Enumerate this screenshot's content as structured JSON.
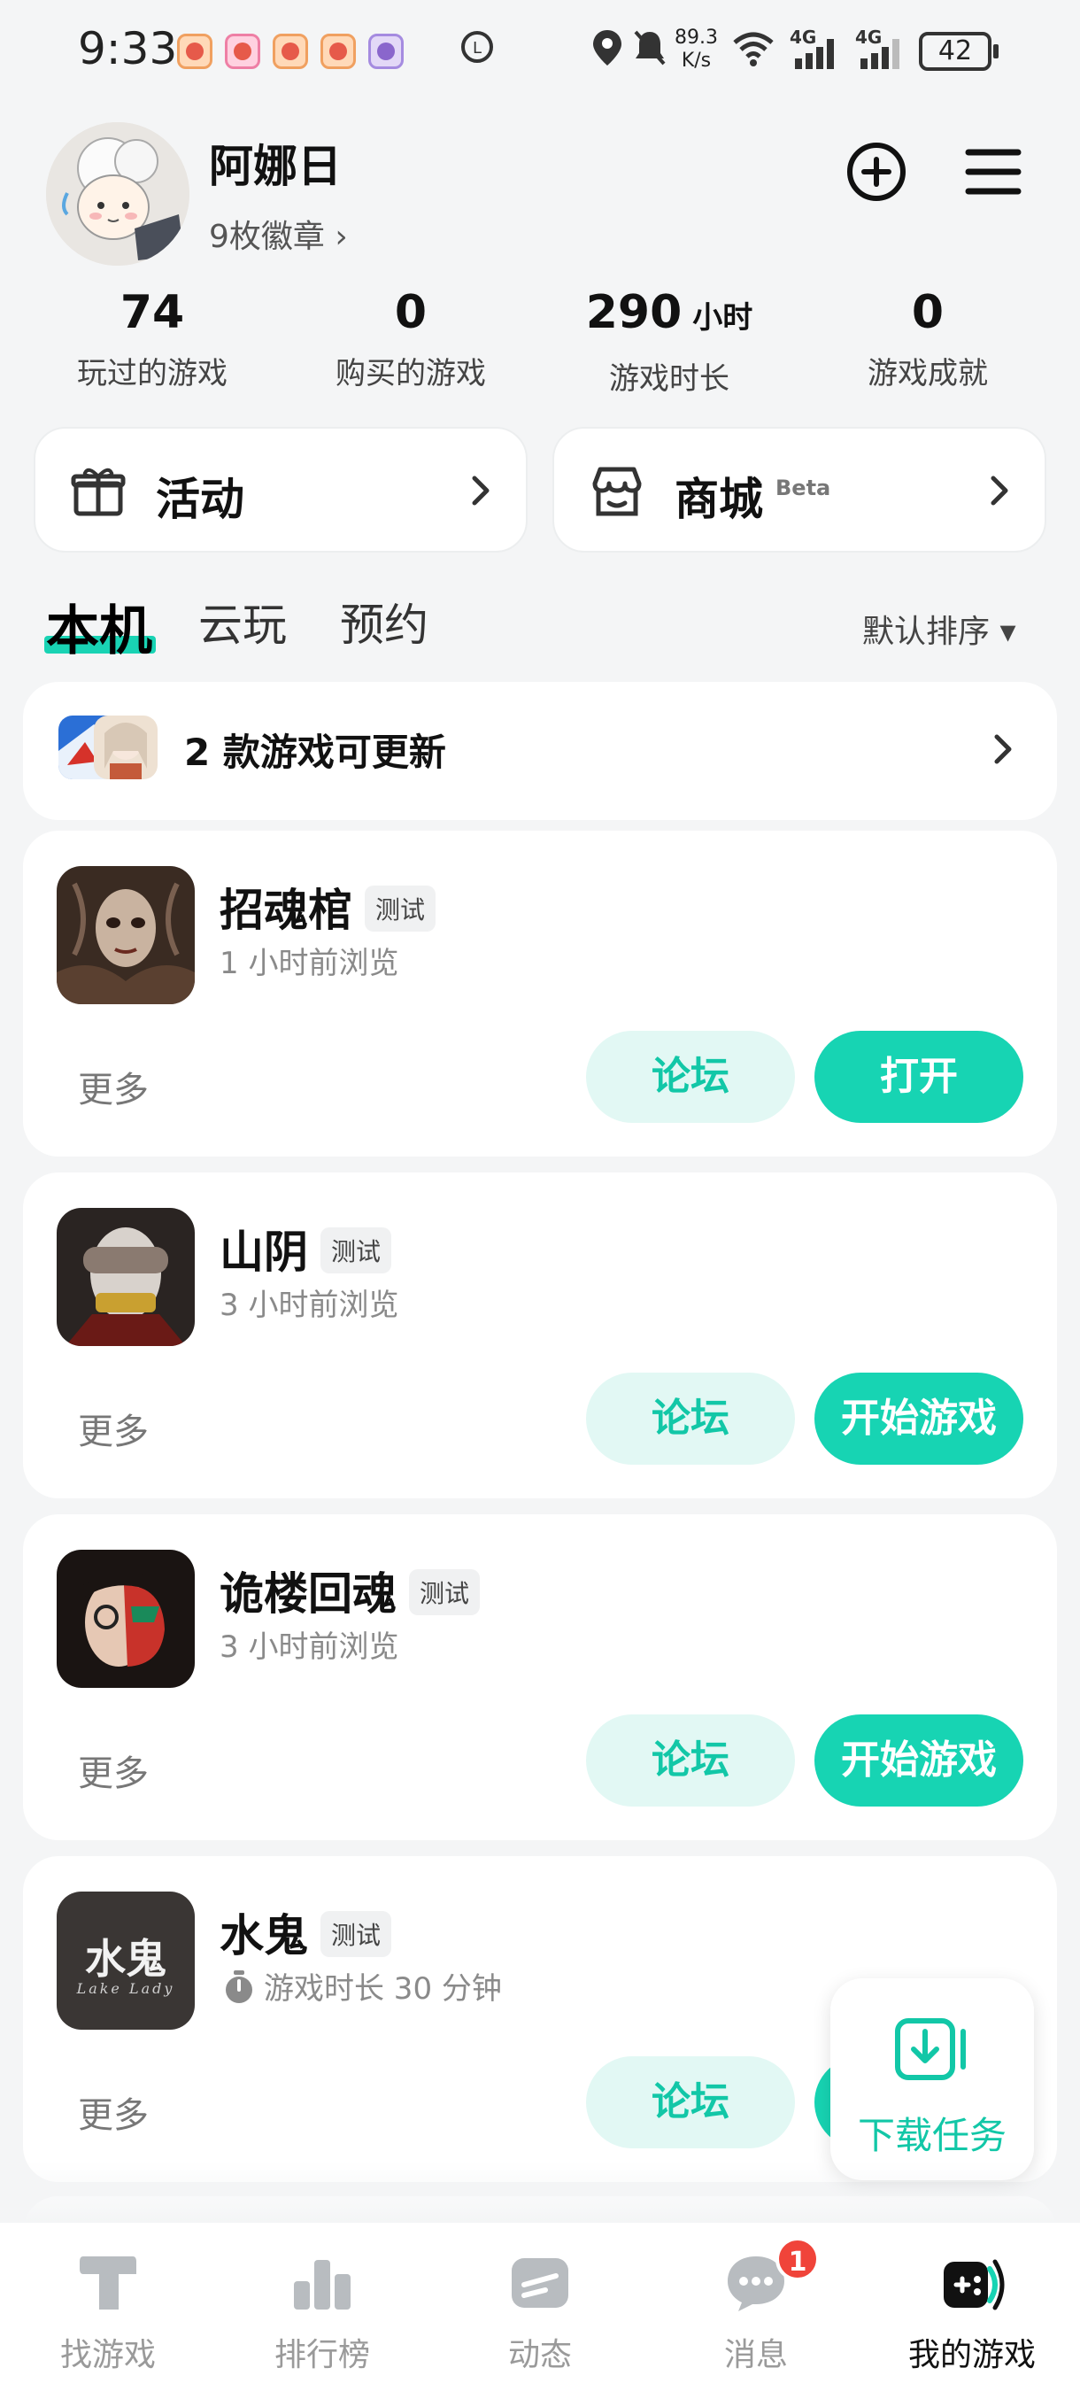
{
  "status_bar": {
    "time": "9:33",
    "net_speed_value": "89.3",
    "net_speed_unit": "K/s",
    "signal1": "4G",
    "signal2": "4G",
    "battery": "42"
  },
  "profile": {
    "username": "阿娜日",
    "badges": "9枚徽章 ›"
  },
  "stats": [
    {
      "value": "74",
      "unit": "",
      "label": "玩过的游戏"
    },
    {
      "value": "0",
      "unit": "",
      "label": "购买的游戏"
    },
    {
      "value": "290",
      "unit": "小时",
      "label": "游戏时长"
    },
    {
      "value": "0",
      "unit": "",
      "label": "游戏成就"
    }
  ],
  "quick_cards": [
    {
      "label": "活动",
      "beta": ""
    },
    {
      "label": "商城",
      "beta": "Beta"
    }
  ],
  "tabs": [
    {
      "label": "本机",
      "active": true
    },
    {
      "label": "云玩",
      "active": false
    },
    {
      "label": "预约",
      "active": false
    }
  ],
  "sort": {
    "label": "默认排序 ▾"
  },
  "update_banner": {
    "text": "2 款游戏可更新"
  },
  "games": [
    {
      "name": "招魂棺",
      "tag": "测试",
      "subtitle": "1 小时前浏览",
      "more": "更多",
      "forum": "论坛",
      "primary": "打开"
    },
    {
      "name": "山阴",
      "tag": "测试",
      "subtitle": "3 小时前浏览",
      "more": "更多",
      "forum": "论坛",
      "primary": "开始游戏"
    },
    {
      "name": "诡楼回魂",
      "tag": "测试",
      "subtitle": "3 小时前浏览",
      "more": "更多",
      "forum": "论坛",
      "primary": "开始游戏"
    },
    {
      "name": "水鬼",
      "tag": "测试",
      "subtitle": "游戏时长 30 分钟",
      "more": "更多",
      "forum": "论坛",
      "primary": ""
    }
  ],
  "float_download": {
    "label": "下载任务"
  },
  "bottom_nav": [
    {
      "label": "找游戏",
      "icon": "find-game-icon",
      "active": false
    },
    {
      "label": "排行榜",
      "icon": "ranking-icon",
      "active": false
    },
    {
      "label": "动态",
      "icon": "feed-icon",
      "active": false
    },
    {
      "label": "消息",
      "icon": "message-icon",
      "active": false,
      "badge": "1"
    },
    {
      "label": "我的游戏",
      "icon": "gamepad-icon",
      "active": true
    }
  ],
  "colors": {
    "accent": "#17d4b3",
    "accent_light": "#e2f8f4",
    "background": "#f4f5f6",
    "badge_red": "#f0443a"
  },
  "thumb_text": {
    "lake_title": "水鬼",
    "lake_sub": "Lake Lady"
  }
}
